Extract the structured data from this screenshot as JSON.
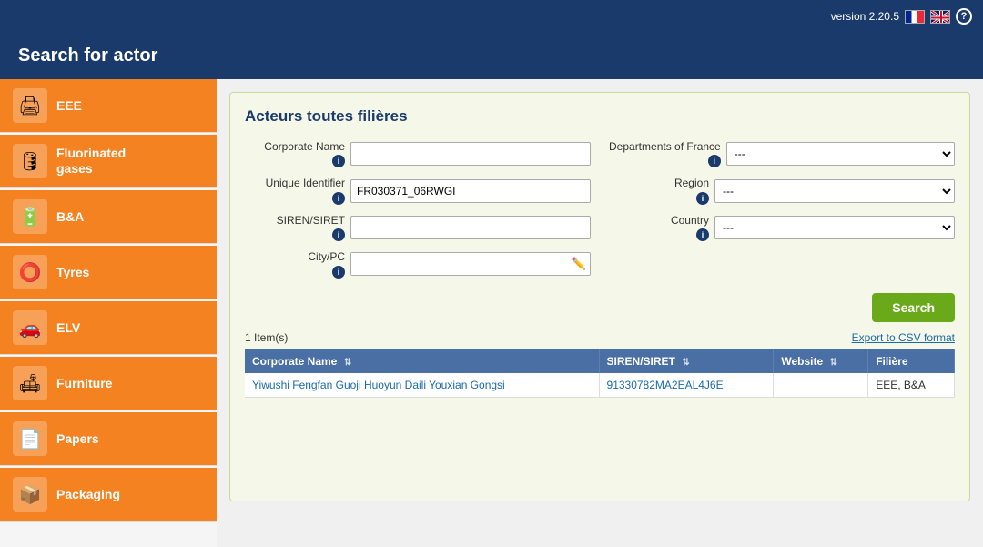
{
  "topbar": {
    "version": "version 2.20.5",
    "help_label": "?"
  },
  "header": {
    "title": "Search for actor"
  },
  "sidebar": {
    "items": [
      {
        "id": "eee",
        "label": "EEE",
        "icon": "🖨"
      },
      {
        "id": "fluorinated",
        "label": "Fluorinated\ngases",
        "icon": "🛢"
      },
      {
        "id": "ba",
        "label": "B&A",
        "icon": "🔋"
      },
      {
        "id": "tyres",
        "label": "Tyres",
        "icon": "⭕"
      },
      {
        "id": "elv",
        "label": "ELV",
        "icon": "🚗"
      },
      {
        "id": "furniture",
        "label": "Furniture",
        "icon": "🛋"
      },
      {
        "id": "papers",
        "label": "Papers",
        "icon": "📄"
      },
      {
        "id": "packaging",
        "label": "Packaging",
        "icon": "📦"
      }
    ]
  },
  "panel": {
    "title": "Acteurs toutes filières"
  },
  "form": {
    "corporate_name_label": "Corporate Name",
    "corporate_name_value": "",
    "corporate_name_placeholder": "",
    "unique_identifier_label": "Unique Identifier",
    "unique_identifier_value": "FR030371_06RWGI",
    "siren_siret_label": "SIREN/SIRET",
    "siren_siret_value": "",
    "siren_siret_placeholder": "",
    "city_pc_label": "City/PC",
    "city_pc_value": "",
    "city_pc_placeholder": "",
    "departments_label": "Departments of France",
    "departments_default": "---",
    "region_label": "Region",
    "region_default": "---",
    "country_label": "Country",
    "country_default": "---",
    "search_button": "Search",
    "export_link": "Export to CSV format"
  },
  "results": {
    "count_label": "1 Item(s)",
    "columns": [
      "Corporate Name",
      "SIREN/SIRET",
      "Website",
      "Filière"
    ],
    "rows": [
      {
        "corporate_name": "Yiwushi Fengfan Guoji Huoyun Daili Youxian Gongsi",
        "siren_siret": "91330782MA2EAL4J6E",
        "website": "",
        "filiere": "EEE, B&A"
      }
    ]
  }
}
